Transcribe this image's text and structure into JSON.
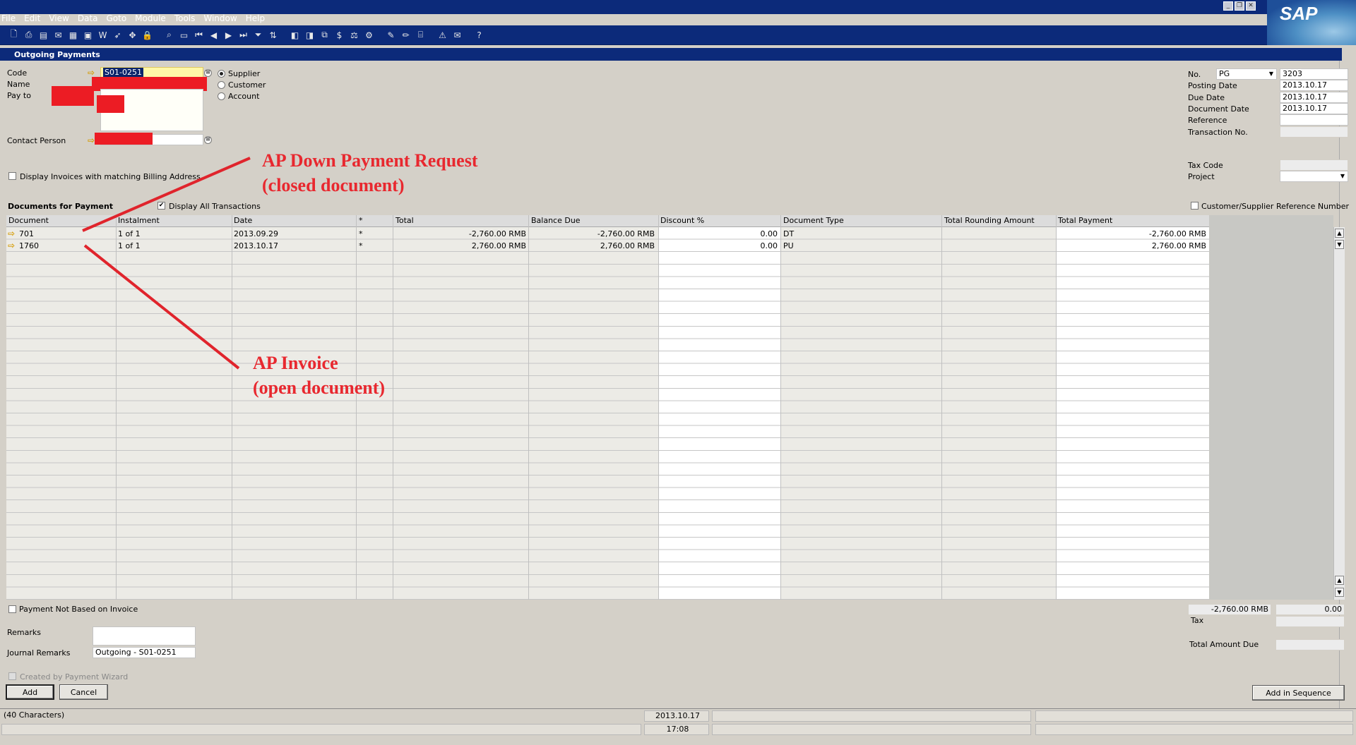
{
  "menu": [
    "File",
    "Edit",
    "View",
    "Data",
    "Goto",
    "Module",
    "Tools",
    "Window",
    "Help"
  ],
  "brand": "SAP",
  "window_title": "Outgoing Payments",
  "header": {
    "code_label": "Code",
    "code_value": "S01-0251",
    "name_label": "Name",
    "pay_to_label": "Pay to",
    "contact_label": "Contact Person",
    "radio_supplier": "Supplier",
    "radio_customer": "Customer",
    "radio_account": "Account",
    "display_invoices_label": "Display Invoices with matching Billing Address"
  },
  "right_panel": {
    "no_label": "No.",
    "series": "PG",
    "number": "3203",
    "posting_date_label": "Posting Date",
    "posting_date": "2013.10.17",
    "due_date_label": "Due Date",
    "due_date": "2013.10.17",
    "document_date_label": "Document Date",
    "document_date": "2013.10.17",
    "reference_label": "Reference",
    "transaction_label": "Transaction No.",
    "tax_code_label": "Tax Code",
    "project_label": "Project",
    "cust_ref_label": "Customer/Supplier Reference Number"
  },
  "grid": {
    "section_label": "Documents for Payment",
    "display_all_label": "Display All Transactions",
    "columns": [
      "Document",
      "Instalment",
      "Date",
      "*",
      "Total",
      "Balance Due",
      "Discount %",
      "Document Type",
      "Total Rounding Amount",
      "Total Payment"
    ],
    "rows": [
      {
        "document": "701",
        "instalment": "1 of 1",
        "date": "2013.09.29",
        "star": "*",
        "total": "-2,760.00 RMB",
        "balance_due": "-2,760.00 RMB",
        "discount": "0.00",
        "doc_type": "DT",
        "rounding": "",
        "total_payment": "-2,760.00 RMB"
      },
      {
        "document": "1760",
        "instalment": "1 of 1",
        "date": "2013.10.17",
        "star": "*",
        "total": "2,760.00 RMB",
        "balance_due": "2,760.00 RMB",
        "discount": "0.00",
        "doc_type": "PU",
        "rounding": "",
        "total_payment": "2,760.00 RMB"
      }
    ]
  },
  "footer": {
    "payment_not_based_label": "Payment Not Based on Invoice",
    "remarks_label": "Remarks",
    "journal_remarks_label": "Journal Remarks",
    "journal_remarks_value": "Outgoing - S01-0251",
    "created_by_wizard_label": "Created by Payment Wizard",
    "add_label": "Add",
    "cancel_label": "Cancel",
    "add_in_sequence_label": "Add in Sequence",
    "sum_total": "-2,760.00 RMB",
    "sum_value": "0.00",
    "tax_label": "Tax",
    "total_amount_due_label": "Total Amount Due"
  },
  "status": {
    "message": "(40 Characters)",
    "date": "2013.10.17",
    "time": "17:08"
  },
  "annotations": {
    "a1_line1": "AP Down Payment Request",
    "a1_line2": "(closed document)",
    "a2_line1": "AP Invoice",
    "a2_line2": "(open document)"
  },
  "colors": {
    "title_bar": "#0c2a7a",
    "annotation_red": "#e8282f",
    "redaction_red": "#ec1c24",
    "code_field_highlight": "#fff8a8"
  }
}
